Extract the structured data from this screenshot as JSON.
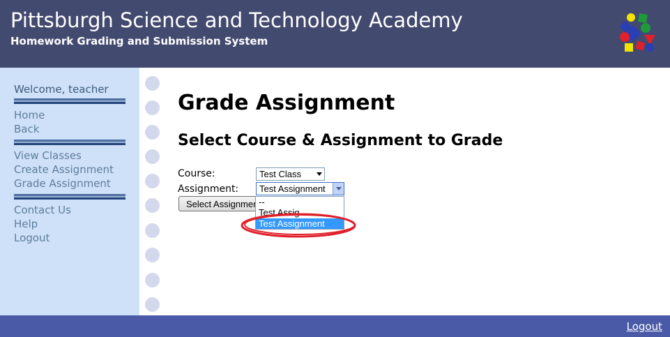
{
  "header": {
    "title": "Pittsburgh Science and Technology Academy",
    "subtitle": "Homework Grading and Submission System"
  },
  "sidebar": {
    "welcome": "Welcome, teacher",
    "group1": [
      {
        "label": "Home"
      },
      {
        "label": "Back"
      }
    ],
    "group2": [
      {
        "label": "View Classes"
      },
      {
        "label": "Create Assignment"
      },
      {
        "label": "Grade Assignment"
      }
    ],
    "group3": [
      {
        "label": "Contact Us"
      },
      {
        "label": "Help"
      },
      {
        "label": "Logout"
      }
    ]
  },
  "main": {
    "heading": "Grade Assignment",
    "subheading": "Select Course & Assignment to Grade",
    "course_label": "Course:",
    "course_value": "Test Class",
    "assignment_label": "Assignment:",
    "assignment_value": "Test Assignment",
    "submit_label": "Select Assignment",
    "dropdown_options": [
      {
        "label": "--"
      },
      {
        "label": "Test Assig"
      },
      {
        "label": "Test Assignment",
        "selected": true
      }
    ]
  },
  "footer": {
    "logout": "Logout"
  },
  "colors": {
    "header_bg": "#434a6f",
    "sidebar_bg": "#cfe1f9",
    "footer_bg": "#4a5aa6",
    "selection": "#3399ff",
    "annotation": "#e0202a"
  }
}
